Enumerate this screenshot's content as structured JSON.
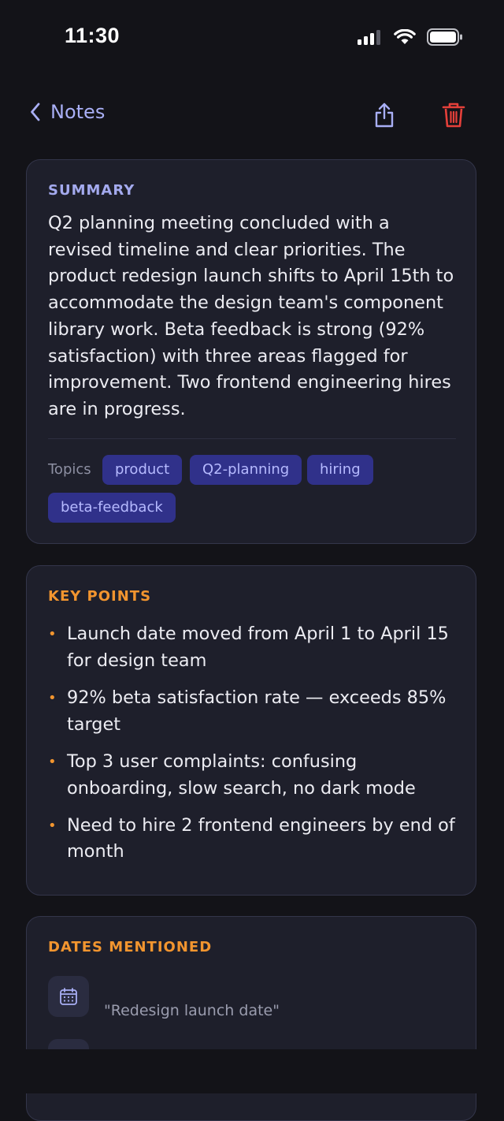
{
  "status_bar": {
    "time": "11:30"
  },
  "nav": {
    "back_label": "Notes",
    "icons": {
      "back": "chevron-left-icon",
      "share": "share-icon",
      "delete": "trash-icon"
    },
    "colors": {
      "accent": "#A9AFF5",
      "delete": "#E5403A"
    }
  },
  "summary": {
    "title": "SUMMARY",
    "text": "Q2 planning meeting concluded with a revised timeline and clear priorities. The product redesign launch shifts to April 15th to accommodate the design team's component library work. Beta feedback is strong (92% satisfaction) with three areas flagged for improvement. Two frontend engineering hires are in progress.",
    "topics_label": "Topics",
    "topics": [
      "product",
      "Q2-planning",
      "hiring",
      "beta-feedback"
    ]
  },
  "key_points": {
    "title": "KEY POINTS",
    "items": [
      "Launch date moved from April 1 to April 15 for design team",
      "92% beta satisfaction rate — exceeds 85% target",
      "Top 3 user complaints: confusing onboarding, slow search, no dark mode",
      "Need to hire 2 frontend engineers by end of month"
    ]
  },
  "dates": {
    "title": "DATES MENTIONED",
    "items": [
      {
        "icon": "calendar-icon",
        "label": "\"Redesign launch date\""
      }
    ]
  },
  "colors": {
    "background": "#131318",
    "card": "#1E1F2B",
    "orange": "#F2952F",
    "tag_bg": "#30318A"
  }
}
